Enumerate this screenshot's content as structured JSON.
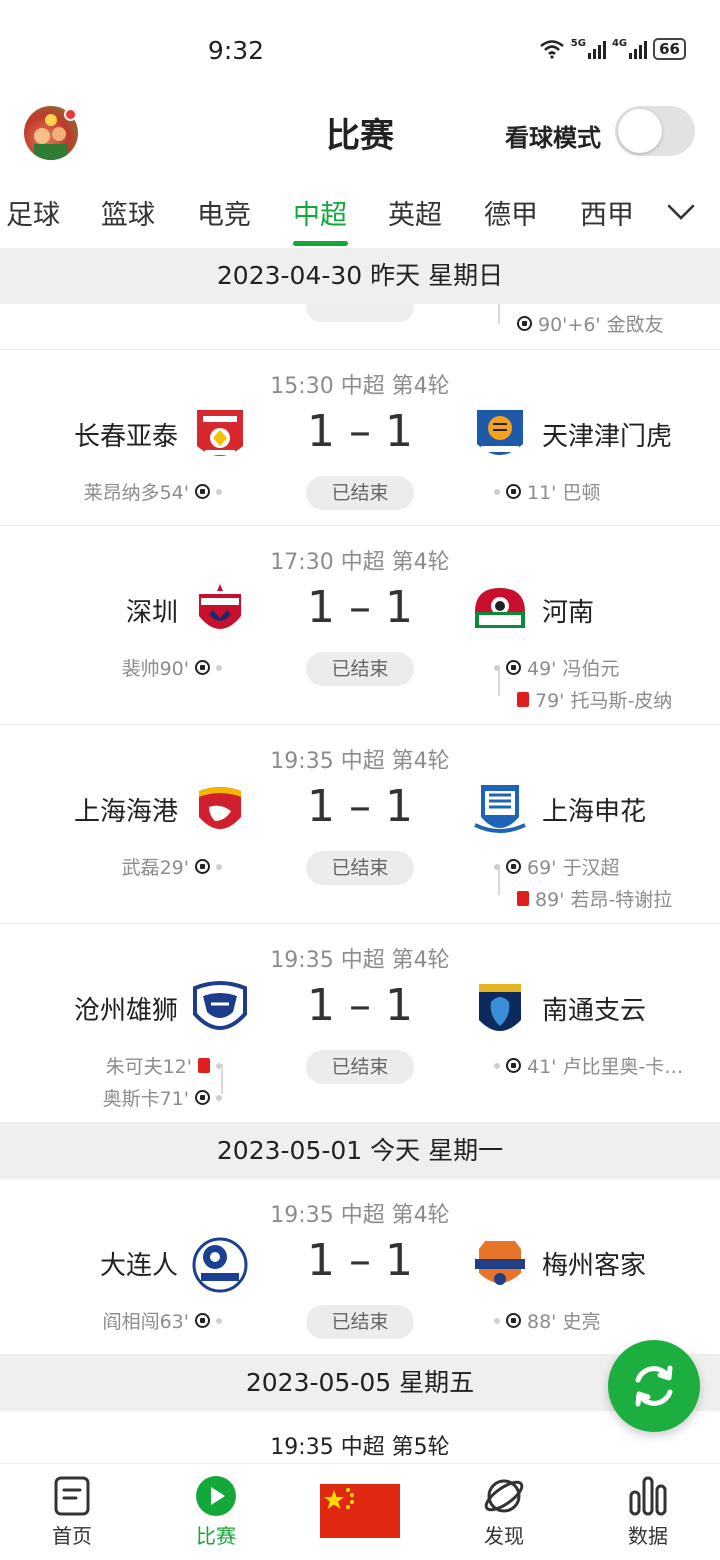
{
  "status_bar": {
    "time": "9:32",
    "net1": "5G",
    "net2": "4G",
    "battery": "66"
  },
  "header": {
    "title": "比赛",
    "watch_mode_label": "看球模式"
  },
  "tabs": [
    "足球",
    "篮球",
    "电竞",
    "中超",
    "英超",
    "德甲",
    "西甲"
  ],
  "active_tab": "中超",
  "sections": [
    {
      "date": "2023-04-30 昨天 星期日"
    },
    {
      "date": "2023-05-01 今天 星期一"
    },
    {
      "date": "2023-05-05 星期五"
    }
  ],
  "partial_top_event": "90'+6' 金敃友",
  "matches": [
    {
      "meta": "15:30 中超 第4轮",
      "home": "长春亚泰",
      "away": "天津津门虎",
      "home_score": "1",
      "away_score": "1",
      "status": "已结束",
      "home_events": [
        "莱昂纳多54'"
      ],
      "away_events": [
        "11' 巴顿"
      ]
    },
    {
      "meta": "17:30 中超 第4轮",
      "home": "深圳",
      "away": "河南",
      "home_score": "1",
      "away_score": "1",
      "status": "已结束",
      "home_events": [
        "裴帅90'"
      ],
      "away_events": [
        "49' 冯伯元",
        "79' 托马斯-皮纳"
      ]
    },
    {
      "meta": "19:35 中超 第4轮",
      "home": "上海海港",
      "away": "上海申花",
      "home_score": "1",
      "away_score": "1",
      "status": "已结束",
      "home_events": [
        "武磊29'"
      ],
      "away_events": [
        "69' 于汉超",
        "89' 若昂-特谢拉"
      ]
    },
    {
      "meta": "19:35 中超 第4轮",
      "home": "沧州雄狮",
      "away": "南通支云",
      "home_score": "1",
      "away_score": "1",
      "status": "已结束",
      "home_events": [
        "朱可夫12'",
        "奥斯卡71'"
      ],
      "away_events": [
        "41' 卢比里奥-卡…"
      ]
    },
    {
      "meta": "19:35 中超 第4轮",
      "home": "大连人",
      "away": "梅州客家",
      "home_score": "1",
      "away_score": "1",
      "status": "已结束",
      "home_events": [
        "阎相闯63'"
      ],
      "away_events": [
        "88' 史亮"
      ]
    }
  ],
  "next_match_meta": "19:35 中超 第5轮",
  "score_separator": "–",
  "bottom_nav": {
    "home": "首页",
    "matches": "比赛",
    "discover": "发现",
    "data": "数据"
  },
  "colors": {
    "accent": "#14a73a",
    "red_card": "#e01e1e",
    "flag_red": "#de2910",
    "flag_star": "#ffde00"
  },
  "icons": [
    "avatar",
    "toggle-switch",
    "chevron-down-icon",
    "soccer-ball-icon",
    "red-card-icon",
    "refresh-icon",
    "home-doc-icon",
    "play-circle-icon",
    "china-flag-icon",
    "discover-planet-icon",
    "bar-chart-icon"
  ]
}
